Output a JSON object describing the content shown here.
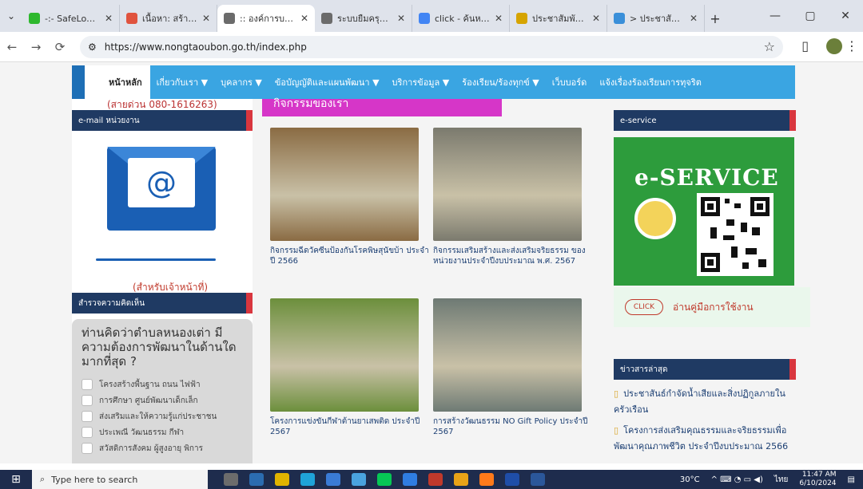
{
  "browser": {
    "tabs": [
      {
        "title": "-:- SafeLog HotS",
        "color": "#2eb82e"
      },
      {
        "title": "เนื้อหา: สร้างใหม่ -",
        "color": "#e0533e"
      },
      {
        "title": ":: องค์การบริหารส่",
        "color": "#6b6b6b",
        "active": true
      },
      {
        "title": "ระบบยืมครุภัณฑ์ออ",
        "color": "#6b6b6b"
      },
      {
        "title": "click - ค้นหาด้วย",
        "color": "#4285f4"
      },
      {
        "title": "ประชาสัมพันธ์ เรื่อ",
        "color": "#d6a400"
      },
      {
        "title": "> ประชาสัมพันธ์ก",
        "color": "#3a8fd9"
      }
    ],
    "url": "https://www.nongtaoubon.go.th/index.php",
    "icons": [
      "star-icon",
      "extensions-icon",
      "profile-avatar",
      "menu-icon"
    ]
  },
  "menu": {
    "items": [
      "หน้าหลัก",
      "เกี่ยวกับเรา ▼",
      "บุคลากร ▼",
      "ข้อบัญญัติและแผนพัฒนา ▼",
      "บริการข้อมูล ▼",
      "ร้องเรียน/ร้องทุกข์ ▼",
      "เว็บบอร์ด",
      "แจ้งเรื่องร้องเรียนการทุจริต"
    ]
  },
  "left": {
    "phone": "(สายด่วน 080-1616263)",
    "email_header": "e-mail หน่วยงาน",
    "envelope_symbol": "@",
    "for_staff": "(สำหรับเจ้าหน้าที่)",
    "survey_header": "สำรวจความคิดเห็น",
    "poll_question": "ท่านคิดว่าตำบลหนองเต่า มีความต้องการพัฒนาในด้านใดมากที่สุด ?",
    "poll_options": [
      "โครงสร้างพื้นฐาน ถนน ไฟฟ้า",
      "การศึกษา ศูนย์พัฒนาเด็กเล็ก",
      "ส่งเสริมและให้ความรู้แก่ประชาชน",
      "ประเพณี วัฒนธรรม กีฬา",
      "สวัสดิการสังคม ผู้สูงอายุ พิการ"
    ]
  },
  "middle": {
    "banner": "กิจกรรมของเรา",
    "activities": [
      {
        "caption": "กิจกรรมฉีดวัคซีนป้องกันโรคพิษสุนัขบ้า ประจำปี 2566",
        "tone": "#8a6b43"
      },
      {
        "caption": "กิจกรรมเสริมสร้างและส่งเสริมจริยธรรม ของหน่วยงานประจำปีงบประมาณ พ.ศ. 2567",
        "tone": "#7b7a6e"
      },
      {
        "caption": "โครงการแข่งขันกีฬาต้านยาเสพติด ประจำปี 2567",
        "tone": "#6c8f3c"
      },
      {
        "caption": "การสร้างวัฒนธรรม NO Gift Policy ประจำปี 2567",
        "tone": "#6e7a74"
      }
    ]
  },
  "right": {
    "eservice_header": "e-service",
    "eservice_label": "e-SERVICE",
    "click_label": "CLICK",
    "manual_link": "อ่านคู่มือการใช้งาน",
    "news_header": "ข่าวสารล่าสุด",
    "news": [
      "ประชาสันธ์กำจัดน้ำเสียและสิ่งปฏิกูลภายในครัวเรือน",
      "โครงการส่งเสริมคุณธรรมและจริยธรรมเพื่อพัฒนาคุณภาพชีวิต ประจำปีงบประมาณ 2566"
    ]
  },
  "taskbar": {
    "search_placeholder": "Type here to search",
    "weather": "30°C",
    "lang": "ไทย",
    "time": "11:47 AM",
    "date": "6/10/2024"
  }
}
